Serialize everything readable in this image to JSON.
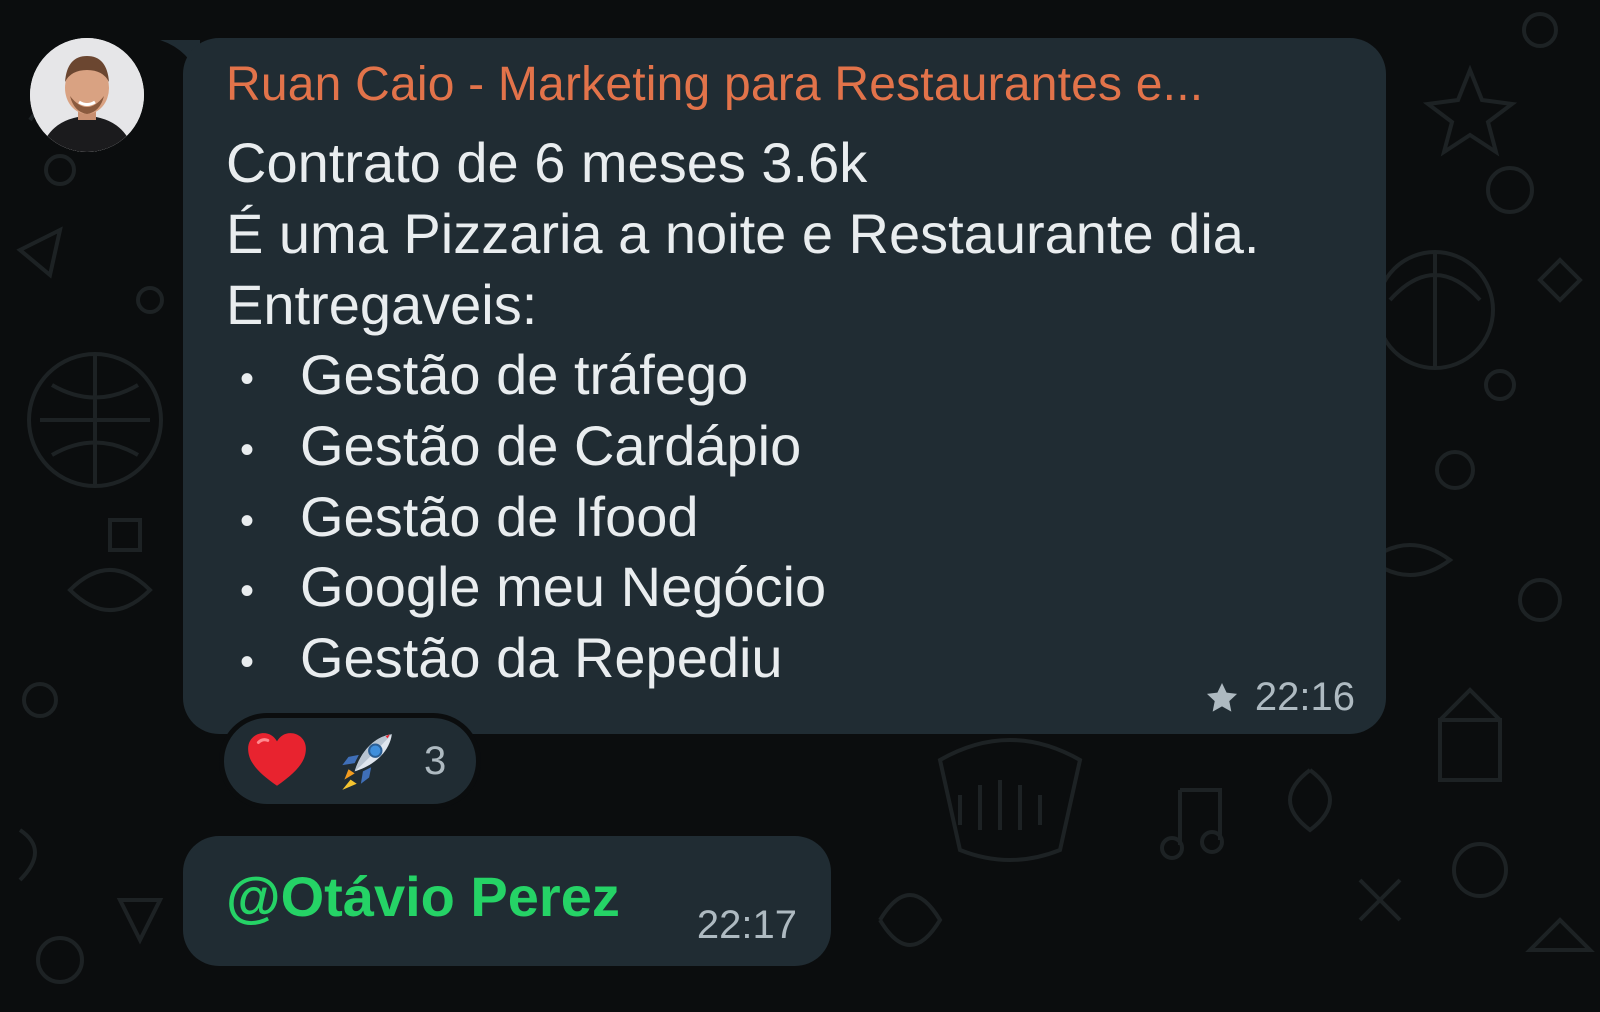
{
  "message": {
    "sender": "Ruan Caio - Marketing para Restaurantes e...",
    "lines": [
      "Contrato de 6 meses 3.6k",
      "É uma Pizzaria a noite e Restaurante dia.",
      "Entregaveis:"
    ],
    "bullets": [
      "Gestão de tráfego",
      "Gestão de Cardápio",
      "Gestão de Ifood",
      "Google meu Negócio",
      "Gestão da Repediu"
    ],
    "bullet_glyph": "•",
    "time": "22:16",
    "starred": true
  },
  "reactions": {
    "emojis": [
      "heart-icon",
      "rocket-icon"
    ],
    "count": "3"
  },
  "reply": {
    "mention": "@Otávio Perez",
    "time": "22:17"
  },
  "colors": {
    "background": "#0b0d0e",
    "bubble": "#202c33",
    "sender": "#e2734a",
    "text": "#e9edef",
    "meta": "#aebac1",
    "mention": "#25d366"
  }
}
